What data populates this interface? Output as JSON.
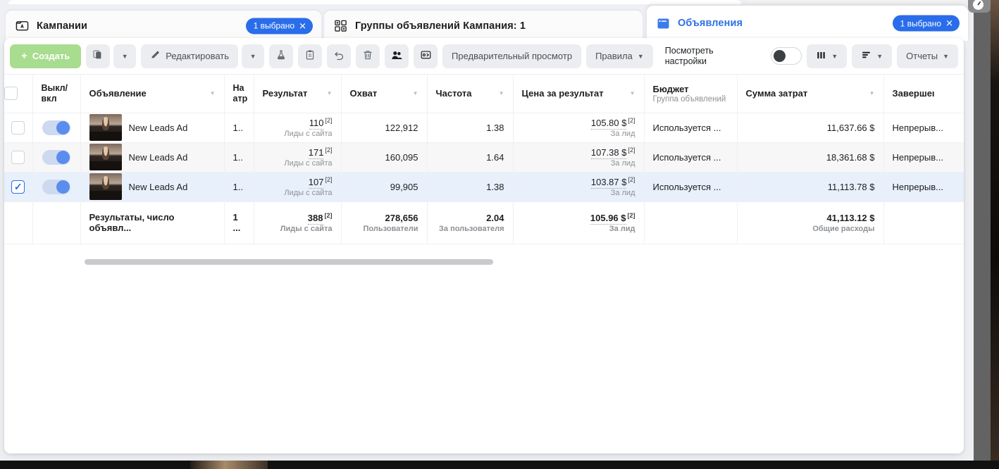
{
  "tabs": [
    {
      "id": "campaigns",
      "icon": "campaign-icon",
      "label": "Кампании",
      "pill": "1 выбрано",
      "pill_close": "✕",
      "has_pill": true
    },
    {
      "id": "adsets",
      "icon": "adsets-grid-icon",
      "label": "Группы объявлений Кампания: 1",
      "pill": "",
      "pill_close": "",
      "has_pill": false
    },
    {
      "id": "ads",
      "icon": "ads-window-icon",
      "label": "Объявления",
      "pill": "1 выбрано",
      "pill_close": "✕",
      "has_pill": true
    }
  ],
  "toolbar": {
    "create_label": "Создать",
    "create_plus": "+",
    "duplicate_icon": "duplicate-icon",
    "duplicate_caret": "▼",
    "edit_label": "Редактировать",
    "edit_icon": "pencil-icon",
    "edit_caret": "▼",
    "ab_test_icon": "flask-icon",
    "clipboard_icon": "clipboard-icon",
    "undo_icon": "undo-arrow-icon",
    "delete_icon": "trash-icon",
    "audience_icon": "people-icon",
    "export_icon": "export-share-icon",
    "preview_label": "Предварительный просмотр",
    "rules_label": "Правила",
    "rules_caret": "▼",
    "view_settings_line1": "Посмотреть",
    "view_settings_line2": "настройки",
    "toggle_name": "view-mode-toggle",
    "columns_icon": "columns-icon",
    "columns_caret": "▼",
    "breakdown_icon": "breakdown-rows-icon",
    "breakdown_caret": "▼",
    "reports_label": "Отчеты",
    "reports_caret": "▼"
  },
  "table": {
    "headers": [
      {
        "id": "checkbox",
        "label": "",
        "sub": "",
        "caret": false,
        "align": "center"
      },
      {
        "id": "onoff",
        "label": "Выкл/\nвкл",
        "sub": "",
        "caret": false,
        "align": "left"
      },
      {
        "id": "ad",
        "label": "Объявление",
        "sub": "",
        "caret": true,
        "align": "left"
      },
      {
        "id": "attribution",
        "label": "На\nатр",
        "sub": "",
        "caret": false,
        "align": "left"
      },
      {
        "id": "result",
        "label": "Результат",
        "sub": "",
        "caret": true,
        "align": "left"
      },
      {
        "id": "reach",
        "label": "Охват",
        "sub": "",
        "caret": true,
        "align": "left"
      },
      {
        "id": "frequency",
        "label": "Частота",
        "sub": "",
        "caret": true,
        "align": "left"
      },
      {
        "id": "cost_per_result",
        "label": "Цена за результат",
        "sub": "",
        "caret": true,
        "align": "left"
      },
      {
        "id": "budget",
        "label": "Бюджет",
        "sub": "Группа объявлений",
        "caret": false,
        "align": "left"
      },
      {
        "id": "amount_spent",
        "label": "Сумма затрат",
        "sub": "",
        "caret": true,
        "align": "left"
      },
      {
        "id": "ends",
        "label": "Завершеı",
        "sub": "",
        "caret": true,
        "align": "left"
      }
    ],
    "rows": [
      {
        "selected": false,
        "toggle_on": true,
        "name": "New Leads Ad",
        "attribution": "1..",
        "result": "110",
        "result_sup": "[2]",
        "result_sub": "Лиды с сайта",
        "reach": "122,912",
        "frequency": "1.38",
        "cost_per_result": "105.80 $",
        "cost_sup": "[2]",
        "cost_sub": "За лид",
        "budget": "Используется ...",
        "amount_spent": "11,637.66 $",
        "ends": "Непрерыв..."
      },
      {
        "selected": false,
        "toggle_on": true,
        "name": "New Leads Ad",
        "attribution": "1..",
        "result": "171",
        "result_sup": "[2]",
        "result_sub": "Лиды с сайта",
        "reach": "160,095",
        "frequency": "1.64",
        "cost_per_result": "107.38 $",
        "cost_sup": "[2]",
        "cost_sub": "За лид",
        "budget": "Используется ...",
        "amount_spent": "18,361.68 $",
        "ends": "Непрерыв..."
      },
      {
        "selected": true,
        "toggle_on": true,
        "name": "New Leads Ad",
        "attribution": "1..",
        "result": "107",
        "result_sup": "[2]",
        "result_sub": "Лиды с сайта",
        "reach": "99,905",
        "frequency": "1.38",
        "cost_per_result": "103.87 $",
        "cost_sup": "[2]",
        "cost_sub": "За лид",
        "budget": "Используется ...",
        "amount_spent": "11,113.78 $",
        "ends": "Непрерыв..."
      }
    ],
    "total": {
      "label": "Результаты, число объявл...",
      "attribution": "1 ...",
      "result": "388",
      "result_sup": "[2]",
      "result_sub": "Лиды с сайта",
      "reach": "278,656",
      "reach_sub": "Пользователи",
      "frequency": "2.04",
      "frequency_sub": "За пользователя",
      "cost_per_result": "105.96 $",
      "cost_sup": "[2]",
      "cost_sub": "За лид",
      "budget": "",
      "amount_spent": "41,113.12 $",
      "amount_spent_sub": "Общие расходы",
      "ends": ""
    }
  },
  "colors": {
    "accent_blue": "#2a6dea",
    "create_green": "#a8dc8e",
    "selected_row": "#e8f0fc",
    "stripe_row": "#f7f7f8",
    "toolbar_btn": "#ebedf0"
  }
}
